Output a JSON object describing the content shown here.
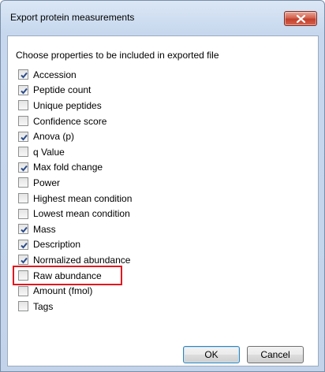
{
  "window": {
    "title": "Export protein measurements",
    "close_icon": "close-icon"
  },
  "instruction": "Choose properties to be included in exported file",
  "options": [
    {
      "label": "Accession",
      "checked": true
    },
    {
      "label": "Peptide count",
      "checked": true
    },
    {
      "label": "Unique peptides",
      "checked": false
    },
    {
      "label": "Confidence score",
      "checked": false
    },
    {
      "label": "Anova (p)",
      "checked": true
    },
    {
      "label": "q Value",
      "checked": false
    },
    {
      "label": "Max fold change",
      "checked": true
    },
    {
      "label": "Power",
      "checked": false
    },
    {
      "label": "Highest mean condition",
      "checked": false
    },
    {
      "label": "Lowest mean condition",
      "checked": false
    },
    {
      "label": "Mass",
      "checked": true
    },
    {
      "label": "Description",
      "checked": true
    },
    {
      "label": "Normalized abundance",
      "checked": true
    },
    {
      "label": "Raw abundance",
      "checked": false,
      "highlighted": true
    },
    {
      "label": "Amount (fmol)",
      "checked": false
    },
    {
      "label": "Tags",
      "checked": false
    }
  ],
  "buttons": {
    "ok_label": "OK",
    "cancel_label": "Cancel"
  },
  "colors": {
    "highlight": "#e2171f",
    "check": "#2a4c8c",
    "close_button": "#c2412d"
  }
}
